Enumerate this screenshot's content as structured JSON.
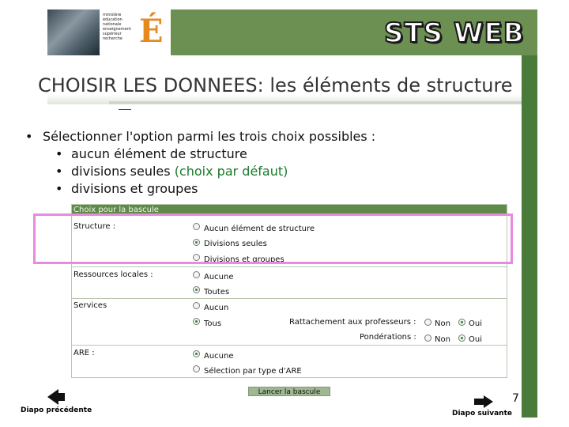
{
  "header": {
    "logo_lines": [
      "ministère",
      "éducation",
      "nationale",
      "enseignement",
      "supérieur",
      "recherche"
    ],
    "app_title": "STS WEB"
  },
  "slide": {
    "title": "CHOISIR LES DONNEES: les éléments de structure",
    "bullet_main": "Sélectionner l'option parmi les trois choix possibles :",
    "sub_items": [
      "aucun élément de structure",
      "divisions seules ",
      "divisions et groupes"
    ],
    "default_note": "(choix par défaut)",
    "page_number": "7"
  },
  "form": {
    "header": "Choix pour la bascule",
    "structure_label": "Structure :",
    "structure_options": [
      "Aucun élément de structure",
      "Divisions seules",
      "Divisions et groupes"
    ],
    "ressources_label": "Ressources locales :",
    "ressources_options": [
      "Aucune",
      "Toutes"
    ],
    "services_label": "Services",
    "services_options": [
      "Aucun",
      "Tous"
    ],
    "rattachement_label": "Rattachement aux professeurs :",
    "ponderations_label": "Pondérations :",
    "non_label": "Non",
    "oui_label": "Oui",
    "are_label": "ARE :",
    "are_options": [
      "Aucune",
      "Sélection par type d'ARE"
    ],
    "launch_button": "Lancer la bascule"
  },
  "nav": {
    "prev": "Diapo précédente",
    "next": "Diapo suivante"
  },
  "colors": {
    "header_green": "#6c8f52",
    "bar_green": "#4a7a3a",
    "highlight_pink": "#e88ae0",
    "default_text_green": "#1a7a2a"
  }
}
